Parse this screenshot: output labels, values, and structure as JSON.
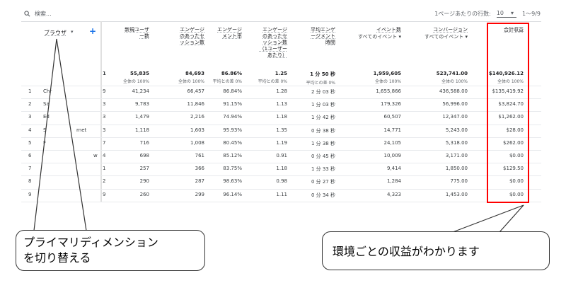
{
  "toolbar": {
    "search_placeholder": "検索...",
    "rows_per_page_label": "1ページあたりの行数:",
    "rows_per_page_value": "10",
    "pagination": "1〜9/9"
  },
  "dimension": {
    "label": "ブラウザ"
  },
  "columns": [
    {
      "label": "新規ユーザー数",
      "lines": [
        "新規ユーザ",
        "ー数"
      ]
    },
    {
      "label": "エンゲージのあったセッション数",
      "lines": [
        "エンゲージ",
        "のあったセ",
        "ッション数"
      ]
    },
    {
      "label": "エンゲージメント率",
      "lines": [
        "エンゲージ",
        "メント率"
      ]
    },
    {
      "label": "エンゲージのあったセッション数（1ユーザーあたり）",
      "lines": [
        "エンゲージ",
        "のあったセ",
        "ッション数",
        "（1ユーザー",
        "あたり）"
      ]
    },
    {
      "label": "平均エンゲージメント時間",
      "lines": [
        "平均エンゲ",
        "ージメント",
        "時間"
      ]
    },
    {
      "label": "イベント数",
      "lines": [
        "イベント数"
      ],
      "sub": "すべてのイベント ▾"
    },
    {
      "label": "コンバージョン",
      "lines": [
        "コンバージョン"
      ],
      "sub": "すべてのイベント ▾"
    },
    {
      "label": "合計収益",
      "lines": [
        "合計収益"
      ]
    }
  ],
  "totals": [
    {
      "value": "55,835",
      "sub": "全体の 100%"
    },
    {
      "value": "84,693",
      "sub": "全体の 100%"
    },
    {
      "value": "86.86%",
      "sub": "平均との差 0%"
    },
    {
      "value": "1.25",
      "sub": "平均との差 0%"
    },
    {
      "value": "1 分 50 秒",
      "sub": "平均との差 0%"
    },
    {
      "value": "1,959,605",
      "sub": "全体の 100%"
    },
    {
      "value": "523,741.00",
      "sub": "全体の 100%"
    },
    {
      "value": "$140,926.12",
      "sub": "全体の 100%"
    }
  ],
  "totals_partial": "1",
  "rows": [
    {
      "idx": "1",
      "browser": "Chr",
      "clipped": "9",
      "cells": [
        "41,234",
        "66,457",
        "86.84%",
        "1.28",
        "2 分 03 秒",
        "1,655,866",
        "436,588.00",
        "$135,419.92"
      ]
    },
    {
      "idx": "2",
      "browser": "Sa",
      "clipped": "3",
      "cells": [
        "9,783",
        "11,846",
        "91.15%",
        "1.13",
        "1 分 03 秒",
        "179,326",
        "56,996.00",
        "$3,824.70"
      ]
    },
    {
      "idx": "3",
      "browser": "Ed",
      "clipped": "3",
      "cells": [
        "1,479",
        "2,216",
        "74.94%",
        "1.18",
        "1 分 42 秒",
        "60,507",
        "12,347.00",
        "$1,262.00"
      ]
    },
    {
      "idx": "4",
      "browser": "S",
      "browser_tail": "rnet",
      "clipped": "3",
      "cells": [
        "1,118",
        "1,603",
        "95.93%",
        "1.35",
        "0 分 38 秒",
        "14,771",
        "5,243.00",
        "$28.00"
      ]
    },
    {
      "idx": "5",
      "browser": "F",
      "clipped": "7",
      "cells": [
        "716",
        "1,008",
        "80.45%",
        "1.19",
        "1 分 38 秒",
        "24,105",
        "5,318.00",
        "$262.00"
      ]
    },
    {
      "idx": "6",
      "browser": "",
      "browser_tail": "w",
      "clipped": "4",
      "cells": [
        "698",
        "761",
        "85.12%",
        "0.91",
        "0 分 45 秒",
        "10,009",
        "3,171.00",
        "$0.00"
      ]
    },
    {
      "idx": "7",
      "browser": "",
      "clipped": "1",
      "cells": [
        "257",
        "366",
        "83.75%",
        "1.18",
        "1 分 33 秒",
        "9,414",
        "1,850.00",
        "$129.50"
      ]
    },
    {
      "idx": "8",
      "browser": "",
      "clipped": "2",
      "cells": [
        "290",
        "287",
        "98.63%",
        "0.98",
        "0 分 27 秒",
        "1,284",
        "775.00",
        "$0.00"
      ]
    },
    {
      "idx": "9",
      "browser": "",
      "clipped": "9",
      "cells": [
        "260",
        "299",
        "96.14%",
        "1.11",
        "0 分 34 秒",
        "4,323",
        "1,453.00",
        "$0.00"
      ]
    }
  ],
  "callouts": {
    "left": [
      "プライマリディメンション",
      "を切り替える"
    ],
    "right": "環境ごとの収益がわかります"
  },
  "colors": {
    "highlight": "#ff0000",
    "accent": "#1a73e8"
  }
}
